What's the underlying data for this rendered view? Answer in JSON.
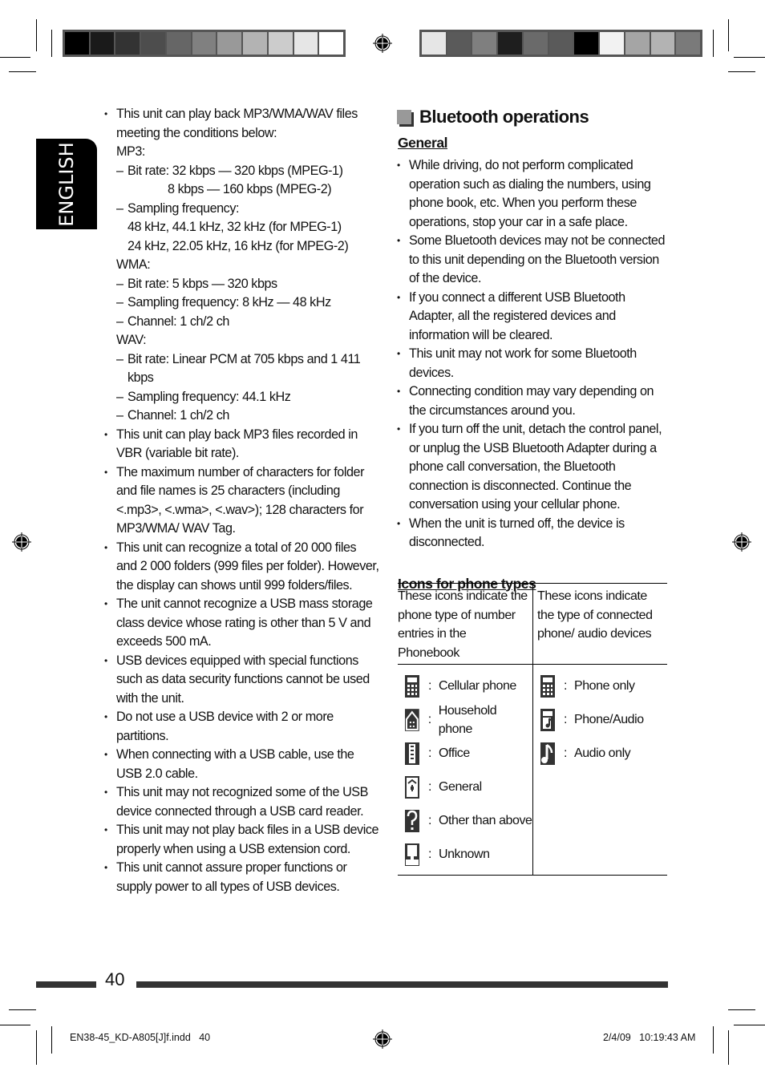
{
  "top_grayscale_left": [
    "#000000",
    "#1a1a1a",
    "#333333",
    "#4d4d4d",
    "#666666",
    "#808080",
    "#999999",
    "#b3b3b3",
    "#cccccc",
    "#e6e6e6",
    "#ffffff"
  ],
  "top_grayscale_right": [
    "#e6e6e6",
    "#5a5a5a",
    "#7f7f7f",
    "#1e1e1e",
    "#6a6a6a",
    "#5a5a5a",
    "#000000",
    "#f2f2f2",
    "#a5a5a5",
    "#b3b3b3",
    "#7a7a7a"
  ],
  "language_tab": "ENGLISH",
  "left_column": {
    "bullets": [
      {
        "text": "This unit can play back MP3/WMA/WAV files meeting the conditions below:",
        "details": [
          {
            "type": "label",
            "text": "MP3:"
          },
          {
            "type": "dash",
            "text": "Bit rate: 32 kbps — 320 kbps (MPEG-1)"
          },
          {
            "type": "cont2",
            "text": "8 kbps — 160 kbps (MPEG-2)"
          },
          {
            "type": "dash",
            "text": "Sampling frequency:"
          },
          {
            "type": "cont1",
            "text": "48 kHz, 44.1 kHz, 32 kHz (for MPEG-1)"
          },
          {
            "type": "cont1",
            "text": "24 kHz, 22.05 kHz, 16 kHz (for MPEG-2)"
          },
          {
            "type": "label",
            "text": "WMA:"
          },
          {
            "type": "dash",
            "text": "Bit rate: 5 kbps — 320 kbps"
          },
          {
            "type": "dash",
            "text": "Sampling frequency: 8 kHz — 48 kHz"
          },
          {
            "type": "dash",
            "text": "Channel: 1 ch/2 ch"
          },
          {
            "type": "label",
            "text": "WAV:"
          },
          {
            "type": "dash",
            "text": "Bit rate: Linear PCM at 705 kbps and 1 411 kbps"
          },
          {
            "type": "dash",
            "text": "Sampling frequency: 44.1 kHz"
          },
          {
            "type": "dash",
            "text": "Channel: 1 ch/2 ch"
          }
        ]
      },
      {
        "text": "This unit can play back MP3 files recorded in VBR (variable bit rate)."
      },
      {
        "text": "The maximum number of characters for folder and file names is 25 characters (including <.mp3>, <.wma>, <.wav>); 128 characters for MP3/WMA/ WAV Tag."
      },
      {
        "text": "This unit can recognize a total of 20 000 files and 2 000 folders (999 files per folder). However, the display can shows until 999 folders/files."
      },
      {
        "text": "The unit cannot recognize a USB mass storage class device whose rating is other than 5 V and exceeds 500 mA."
      },
      {
        "text": "USB devices equipped with special functions such as data security functions cannot be used with the unit."
      },
      {
        "text": "Do not use a USB device with 2 or more partitions."
      },
      {
        "text": "When connecting with a USB cable, use the USB 2.0 cable."
      },
      {
        "text": "This unit may not recognized some of the USB device connected through a USB card reader."
      },
      {
        "text": "This unit may not play back files in a USB device properly when using a USB extension cord."
      },
      {
        "text": "This unit cannot assure proper functions or supply power to all types of USB devices."
      }
    ]
  },
  "right_column": {
    "section_title": "Bluetooth operations",
    "general_heading": "General",
    "general_bullets": [
      "While driving, do not perform complicated operation such as dialing the numbers, using phone book, etc. When you perform these operations, stop your car in a safe place.",
      "Some Bluetooth devices may not be connected to this unit depending on the Bluetooth version of the device.",
      "If you connect a different USB Bluetooth Adapter, all the registered devices and information will be cleared.",
      "This unit may not work for some Bluetooth devices.",
      "Connecting condition may vary depending on the circumstances around you.",
      "If you turn off the unit, detach the control panel, or unplug the USB Bluetooth Adapter during a phone call conversation, the Bluetooth connection is disconnected. Continue the conversation using your cellular phone.",
      "When the unit is turned off, the device is disconnected."
    ],
    "icons_heading": "Icons for phone types",
    "table": {
      "header_left": "These icons indicate the phone type of number entries in the Phonebook",
      "header_right": "These icons indicate the type of connected phone/ audio devices",
      "left_items": [
        {
          "icon": "cellular-phone-icon",
          "label": "Cellular phone"
        },
        {
          "icon": "household-phone-icon",
          "label": "Household phone"
        },
        {
          "icon": "office-icon",
          "label": "Office"
        },
        {
          "icon": "general-icon",
          "label": "General"
        },
        {
          "icon": "question-icon",
          "label": "Other than above"
        },
        {
          "icon": "unknown-person-icon",
          "label": "Unknown"
        }
      ],
      "right_items": [
        {
          "icon": "phone-only-icon",
          "label": "Phone only"
        },
        {
          "icon": "phone-audio-icon",
          "label": "Phone/Audio"
        },
        {
          "icon": "audio-only-icon",
          "label": "Audio only"
        }
      ],
      "separator": ":"
    }
  },
  "footer": {
    "page_number": "40",
    "slug_file": "EN38-45_KD-A805[J]f.indd   40",
    "slug_date": "2/4/09   10:19:43 AM"
  }
}
